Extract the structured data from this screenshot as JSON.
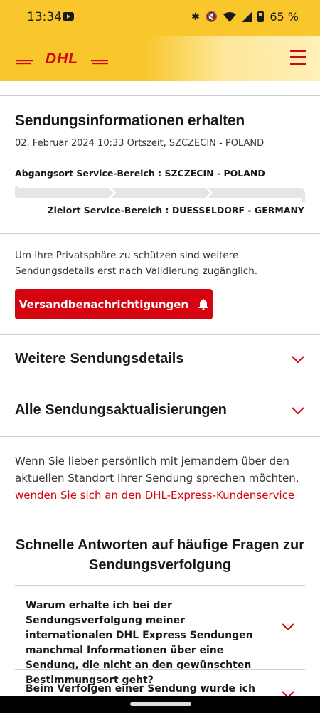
{
  "status_bar": {
    "time": "13:34",
    "battery": "65 %"
  },
  "header": {
    "logo": "DHL"
  },
  "shipment": {
    "title": "Sendungsinformationen erhalten",
    "datetime": "02. Februar 2024 10:33 Ortszeit, SZCZECIN - POLAND",
    "origin": "Abgangsort Service-Bereich : SZCZECIN - POLAND",
    "destination": "Zielort Service-Bereich : DUESSELDORF - GERMANY"
  },
  "privacy_note": "Um Ihre Privatsphäre zu schützen sind weitere Sendungsdetails erst nach Validierung zugänglich.",
  "notify_button": "Versandbenachrichtigungen",
  "accordions": [
    {
      "label": "Weitere Sendungsdetails"
    },
    {
      "label": "Alle Sendungsaktualisierungen"
    }
  ],
  "contact": {
    "text": "Wenn Sie lieber persönlich mit jemandem über den aktuellen Standort Ihrer Sendung sprechen möchten,",
    "link": "wenden Sie sich an den DHL-Express-Kundenservice"
  },
  "faq": {
    "heading": "Schnelle Antworten auf häufige Fragen zur Sendungsverfolgung",
    "questions": [
      "Warum erhalte ich bei der Sendungsverfolgung meiner internationalen DHL Express Sendungen manchmal Informationen über eine Sendung, die nicht an den gewünschten Bestimmungsort geht?",
      "Beim Verfolgen einer Sendung wurde ich"
    ]
  },
  "colors": {
    "brand_yellow": "#f9c62b",
    "brand_red": "#d40511"
  }
}
